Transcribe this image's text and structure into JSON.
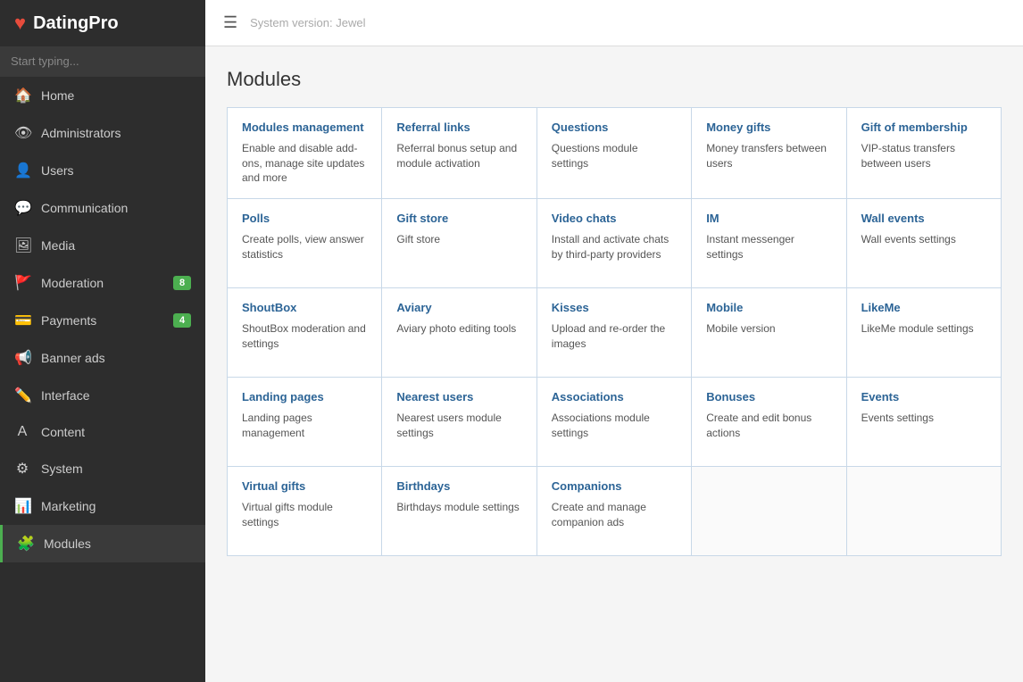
{
  "app": {
    "logo_text": "DatingPro",
    "system_version": "System version: Jewel",
    "search_placeholder": "Start typing..."
  },
  "sidebar": {
    "items": [
      {
        "id": "home",
        "label": "Home",
        "icon": "🏠",
        "badge": null
      },
      {
        "id": "administrators",
        "label": "Administrators",
        "icon": "👁",
        "badge": null
      },
      {
        "id": "users",
        "label": "Users",
        "icon": "👤",
        "badge": null
      },
      {
        "id": "communication",
        "label": "Communication",
        "icon": "💬",
        "badge": null
      },
      {
        "id": "media",
        "label": "Media",
        "icon": "🖼",
        "badge": null
      },
      {
        "id": "moderation",
        "label": "Moderation",
        "icon": "🚩",
        "badge": "8"
      },
      {
        "id": "payments",
        "label": "Payments",
        "icon": "💳",
        "badge": "4"
      },
      {
        "id": "banner-ads",
        "label": "Banner ads",
        "icon": "📢",
        "badge": null
      },
      {
        "id": "interface",
        "label": "Interface",
        "icon": "✏️",
        "badge": null
      },
      {
        "id": "content",
        "label": "Content",
        "icon": "A",
        "badge": null
      },
      {
        "id": "system",
        "label": "System",
        "icon": "⚙",
        "badge": null
      },
      {
        "id": "marketing",
        "label": "Marketing",
        "icon": "📊",
        "badge": null
      },
      {
        "id": "modules",
        "label": "Modules",
        "icon": "🧩",
        "badge": null
      }
    ]
  },
  "page": {
    "title": "Modules"
  },
  "modules": [
    {
      "id": "modules-management",
      "name": "Modules management",
      "desc": "Enable and disable add-ons, manage site updates and more"
    },
    {
      "id": "referral-links",
      "name": "Referral links",
      "desc": "Referral bonus setup and module activation"
    },
    {
      "id": "questions",
      "name": "Questions",
      "desc": "Questions module settings"
    },
    {
      "id": "money-gifts",
      "name": "Money gifts",
      "desc": "Money transfers between users"
    },
    {
      "id": "gift-of-membership",
      "name": "Gift of membership",
      "desc": "VIP-status transfers between users"
    },
    {
      "id": "polls",
      "name": "Polls",
      "desc": "Create polls, view answer statistics"
    },
    {
      "id": "gift-store",
      "name": "Gift store",
      "desc": "Gift store"
    },
    {
      "id": "video-chats",
      "name": "Video chats",
      "desc": "Install and activate chats by third-party providers"
    },
    {
      "id": "im",
      "name": "IM",
      "desc": "Instant messenger settings"
    },
    {
      "id": "wall-events",
      "name": "Wall events",
      "desc": "Wall events settings"
    },
    {
      "id": "shoutbox",
      "name": "ShoutBox",
      "desc": "ShoutBox moderation and settings"
    },
    {
      "id": "aviary",
      "name": "Aviary",
      "desc": "Aviary photo editing tools"
    },
    {
      "id": "kisses",
      "name": "Kisses",
      "desc": "Upload and re-order the images"
    },
    {
      "id": "mobile",
      "name": "Mobile",
      "desc": "Mobile version"
    },
    {
      "id": "likeme",
      "name": "LikeMe",
      "desc": "LikeMe module settings"
    },
    {
      "id": "landing-pages",
      "name": "Landing pages",
      "desc": "Landing pages management"
    },
    {
      "id": "nearest-users",
      "name": "Nearest users",
      "desc": "Nearest users module settings"
    },
    {
      "id": "associations",
      "name": "Associations",
      "desc": "Associations module settings"
    },
    {
      "id": "bonuses",
      "name": "Bonuses",
      "desc": "Create and edit bonus actions"
    },
    {
      "id": "events",
      "name": "Events",
      "desc": "Events settings"
    },
    {
      "id": "virtual-gifts",
      "name": "Virtual gifts",
      "desc": "Virtual gifts module settings"
    },
    {
      "id": "birthdays",
      "name": "Birthdays",
      "desc": "Birthdays module settings"
    },
    {
      "id": "companions",
      "name": "Companions",
      "desc": "Create and manage companion ads"
    }
  ]
}
